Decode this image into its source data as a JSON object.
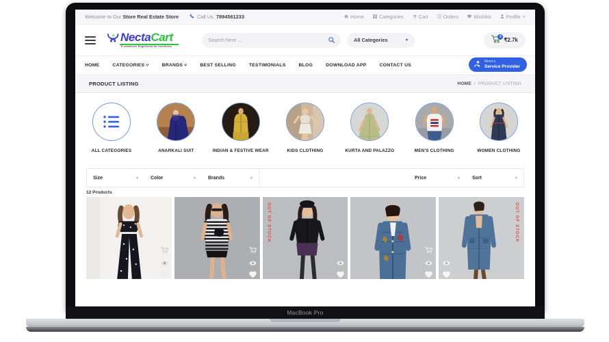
{
  "device": {
    "model_label": "MacBook Pro"
  },
  "topbar": {
    "welcome_prefix": "Welcome to Our ",
    "welcome_store": "Store Real Estate Store",
    "call_label": "Call Us ",
    "call_number": "7894561233",
    "phone_icon": "phone-icon",
    "links": [
      {
        "label": "Home",
        "icon": "home-icon"
      },
      {
        "label": "Categories",
        "icon": "grid-icon"
      },
      {
        "label": "Cart",
        "icon": "cart-icon"
      },
      {
        "label": "Orders",
        "icon": "list-icon"
      },
      {
        "label": "Wishlist",
        "icon": "heart-icon"
      },
      {
        "label": "Profile",
        "icon": "user-icon",
        "caret": "˅"
      }
    ]
  },
  "header": {
    "menu_icon": "hamburger-icon",
    "logo": {
      "name_part1": "Necta",
      "name_part2": "Cart",
      "tagline": "E-commerce Engineered for excellence",
      "mark_icon": "shopping-cart-logo-icon",
      "color_part1": "#3b3bd6",
      "color_part2": "#2fbf3f"
    },
    "search": {
      "placeholder": "Search here ...",
      "value": "",
      "icon": "search-icon"
    },
    "category_select": {
      "value": "All Categories",
      "caret": "▾"
    },
    "cart": {
      "icon": "cart-icon",
      "badge": "2",
      "amount": "₹2.7k"
    }
  },
  "nav": {
    "items": [
      {
        "label": "HOME"
      },
      {
        "label": "CATEGORIES",
        "caret": "˅"
      },
      {
        "label": "BRANDS",
        "caret": "˅"
      },
      {
        "label": "BEST SELLING"
      },
      {
        "label": "TESTIMONIALS"
      },
      {
        "label": "BLOG"
      },
      {
        "label": "DOWNLOAD APP"
      },
      {
        "label": "CONTACT US"
      }
    ],
    "service_button": {
      "line1": "Need a",
      "line2": "Service Provider",
      "icon": "service-gear-icon",
      "color": "#3161e3"
    }
  },
  "breadcrumb": {
    "page_title": "PRODUCT LISTING",
    "home": "HOME",
    "separator": "/",
    "current": "PRODUCT LISTING"
  },
  "categories": [
    {
      "label": "ALL CATEGORIES",
      "icon": "list-bullets-icon",
      "type": "icon"
    },
    {
      "label": "ANARKALI SUIT",
      "type": "photo"
    },
    {
      "label": "INDIAN & FESTIVE WEAR",
      "type": "photo"
    },
    {
      "label": "KIDS CLOTHING",
      "type": "photo"
    },
    {
      "label": "KURTA AND PALAZZO",
      "type": "photo"
    },
    {
      "label": "MEN'S CLOTHING",
      "type": "photo"
    },
    {
      "label": "WOMEN CLOTHING",
      "type": "photo"
    }
  ],
  "filters": {
    "left": [
      {
        "label": "Size",
        "caret": "▾"
      },
      {
        "label": "Color",
        "caret": "▾"
      },
      {
        "label": "Brands",
        "caret": "▾"
      }
    ],
    "right": [
      {
        "label": "Price",
        "caret": "▾"
      },
      {
        "label": "Sort",
        "caret": "▾"
      }
    ]
  },
  "results": {
    "count_label": "12 Products"
  },
  "products": [
    {
      "out_of_stock": false,
      "stock_label": "",
      "actions": [
        "cart-icon",
        "eye-icon",
        "heart-icon"
      ]
    },
    {
      "out_of_stock": false,
      "stock_label": "",
      "actions": [
        "cart-icon",
        "eye-icon",
        "heart-icon"
      ]
    },
    {
      "out_of_stock": true,
      "stock_label": "OUT OF STOCK",
      "actions": [
        "eye-icon",
        "heart-icon"
      ]
    },
    {
      "out_of_stock": false,
      "stock_label": "",
      "actions": [
        "cart-icon",
        "eye-icon",
        "heart-icon"
      ]
    },
    {
      "out_of_stock": true,
      "stock_label": "OUT OF STOCK",
      "actions": [
        "eye-icon",
        "heart-icon"
      ]
    }
  ]
}
